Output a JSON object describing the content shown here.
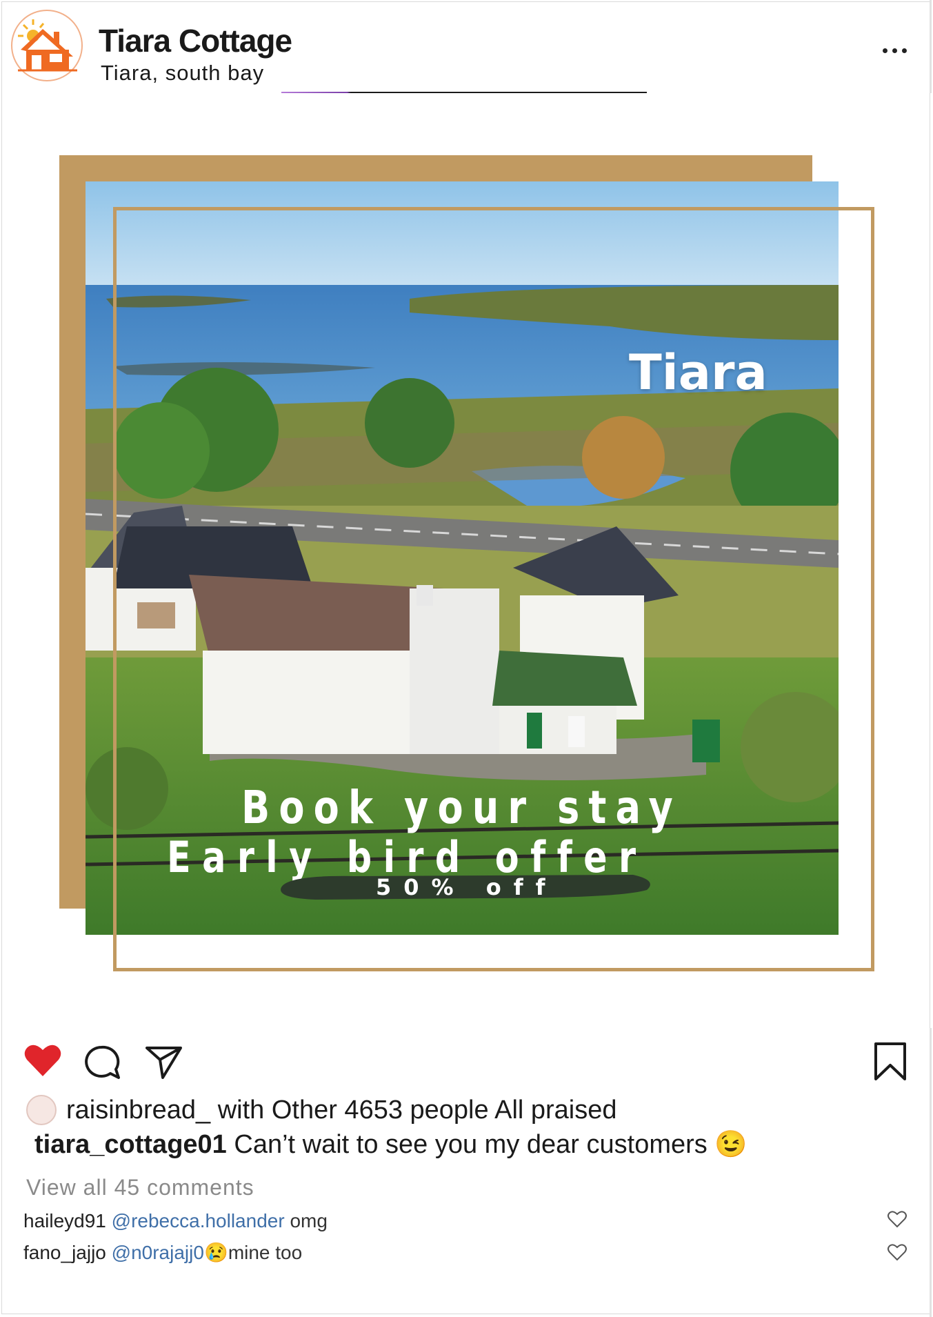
{
  "header": {
    "account_name": "Tiara Cottage",
    "location": "Tiara, south bay",
    "avatar_icon": "house-sun-icon",
    "more_icon": "more-options-icon"
  },
  "post_image": {
    "place_label": "Tiara",
    "headline": "Book your stay",
    "subheadline": "Early bird offer",
    "discount": "50% off",
    "frame_color": "#c19a61"
  },
  "actions": {
    "like_icon": "heart-icon",
    "liked": true,
    "like_color": "#e0252b",
    "comment_icon": "comment-bubble-icon",
    "share_icon": "paper-plane-icon",
    "save_icon": "bookmark-icon"
  },
  "likes": {
    "first_user": "raisinbread_",
    "text": "with Other 4653 people All praised"
  },
  "caption": {
    "username": "tiara_cottage01",
    "text": "Can’t wait to see you my dear customers",
    "emoji": "😉"
  },
  "comments": {
    "view_all": "View all 45 comments",
    "items": [
      {
        "user": "haileyd91",
        "mention": "@rebecca.hollander",
        "text": "omg",
        "emoji": ""
      },
      {
        "user": "fano_jajjo",
        "mention": "@n0rajajj0",
        "text": "mine too",
        "emoji": "😢"
      }
    ]
  }
}
